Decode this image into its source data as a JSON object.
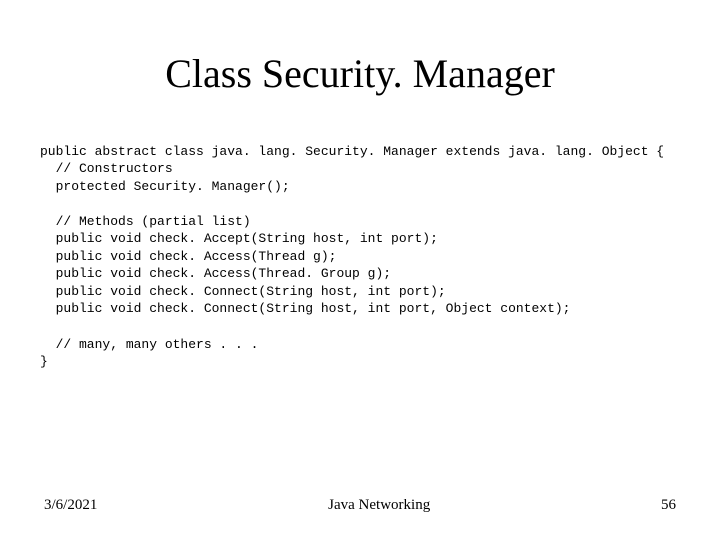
{
  "title": "Class Security. Manager",
  "code": {
    "l01": "public abstract class java. lang. Security. Manager extends java. lang. Object {",
    "l02": "  // Constructors",
    "l03": "  protected Security. Manager();",
    "l04": "",
    "l05": "  // Methods (partial list)",
    "l06": "  public void check. Accept(String host, int port);",
    "l07": "  public void check. Access(Thread g);",
    "l08": "  public void check. Access(Thread. Group g);",
    "l09": "  public void check. Connect(String host, int port);",
    "l10": "  public void check. Connect(String host, int port, Object context);",
    "l11": "",
    "l12": "  // many, many others . . .",
    "l13": "}"
  },
  "footer": {
    "date": "3/6/2021",
    "center": "Java Networking",
    "page": "56"
  }
}
